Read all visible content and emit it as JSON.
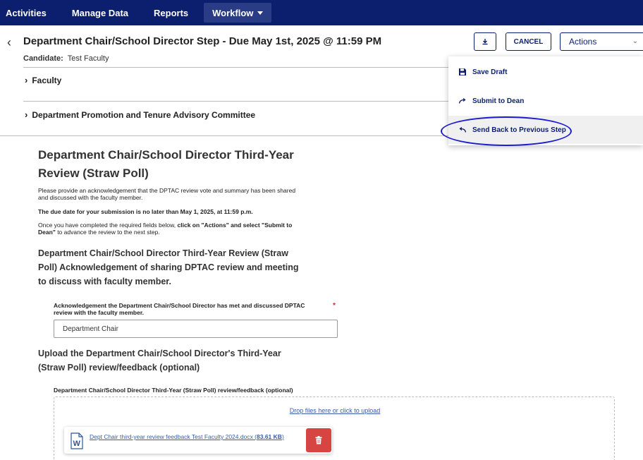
{
  "nav": {
    "items": [
      "Activities",
      "Manage Data",
      "Reports"
    ],
    "active": "Workflow"
  },
  "header": {
    "title": "Department Chair/School Director Step - Due May 1st, 2025 @ 11:59 PM",
    "candidate_label": "Candidate:",
    "candidate_value": "Test Faculty",
    "cancel_label": "CANCEL",
    "actions_label": "Actions"
  },
  "sections": [
    {
      "label": "Faculty"
    },
    {
      "label": "Department Promotion and Tenure Advisory Committee"
    }
  ],
  "actions_menu": [
    {
      "label": "Save Draft",
      "icon": "save-icon"
    },
    {
      "label": "Submit to Dean",
      "icon": "forward-arrow-icon"
    },
    {
      "label": "Send Back to Previous Step",
      "icon": "back-arrow-icon"
    }
  ],
  "form": {
    "title": "Department Chair/School Director Third-Year Review (Straw Poll)",
    "para1": "Please provide an acknowledgement that the DPTAC review vote and summary has been shared and discussed with the faculty member.",
    "para2": "The due date for your submission is no later than May 1, 2025, at 11:59 p.m.",
    "para3_a": "Once you have completed the required fields below, ",
    "para3_b": "click on \"Actions\" and select \"Submit to Dean\"",
    "para3_c": " to advance the review to the next step.",
    "sub_heading1": "Department Chair/School Director Third-Year Review (Straw Poll) Acknowledgement of sharing DPTAC review and meeting to discuss with faculty member.",
    "field1_label": "Acknowledgement the Department Chair/School Director has met and discussed DPTAC review with the faculty member.",
    "field1_required": "*",
    "field1_value": "Department Chair",
    "sub_heading2": "Upload the Department Chair/School Director's Third-Year (Straw Poll) review/feedback (optional)",
    "field2_label": "Department Chair/School Director Third-Year (Straw Poll) review/feedback (optional)",
    "dropzone_text": "Drop files here or click to upload",
    "file_name": "Dept Chair third-year review feedback Test Faculty 2024.docx (",
    "file_size": "83.61 KB",
    "file_close": ")"
  }
}
